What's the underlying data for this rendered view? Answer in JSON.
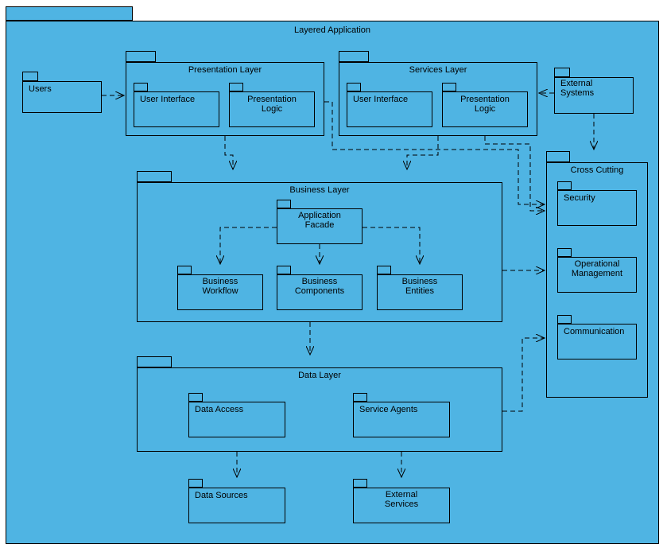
{
  "root": {
    "title": "Layered Application"
  },
  "users": {
    "title": "Users"
  },
  "externalSystems": {
    "title": "External\nSystems"
  },
  "presentation": {
    "title": "Presentation Layer",
    "ui": "User Interface",
    "logic": "Presentation\nLogic"
  },
  "services": {
    "title": "Services Layer",
    "ui": "User Interface",
    "logic": "Presentation\nLogic"
  },
  "business": {
    "title": "Business Layer",
    "facade": "Application\nFacade",
    "workflow": "Business\nWorkflow",
    "components": "Business\nComponents",
    "entities": "Business\nEntities"
  },
  "data": {
    "title": "Data Layer",
    "access": "Data Access",
    "agents": "Service Agents"
  },
  "dataSources": {
    "title": "Data Sources"
  },
  "externalServices": {
    "title": "External\nServices"
  },
  "cross": {
    "title": "Cross Cutting",
    "security": "Security",
    "opMgmt": "Operational\nManagement",
    "comm": "Communication"
  }
}
